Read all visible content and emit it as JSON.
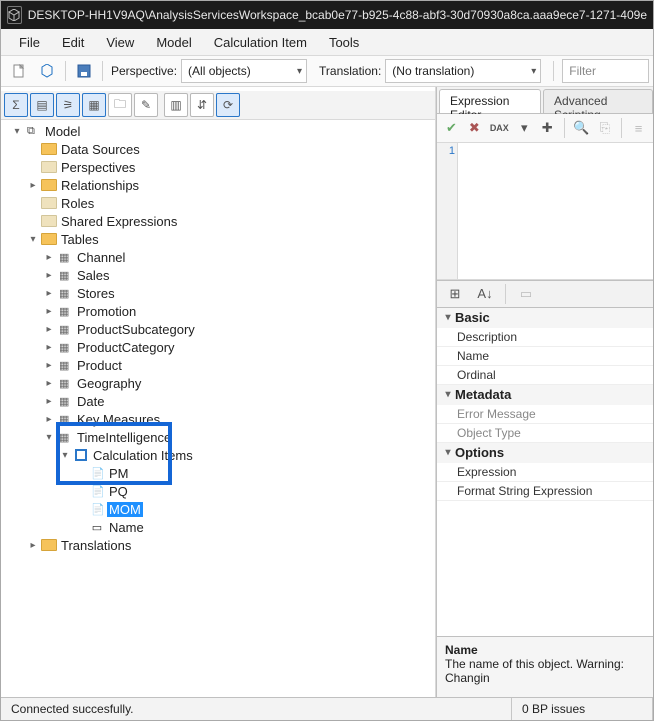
{
  "title": "DESKTOP-HH1V9AQ\\AnalysisServicesWorkspace_bcab0e77-b925-4c88-abf3-30d70930a8ca.aaa9ece7-1271-409e",
  "menu": [
    "File",
    "Edit",
    "View",
    "Model",
    "Calculation Item",
    "Tools"
  ],
  "toolbar": {
    "perspective_label": "Perspective:",
    "perspective_value": "(All objects)",
    "translation_label": "Translation:",
    "translation_value": "(No translation)",
    "filter_placeholder": "Filter"
  },
  "tree": {
    "root": "Model",
    "dataSources": "Data Sources",
    "perspectives": "Perspectives",
    "relationships": "Relationships",
    "roles": "Roles",
    "sharedExpr": "Shared Expressions",
    "tables": "Tables",
    "tablesList": [
      "Channel",
      "Sales",
      "Stores",
      "Promotion",
      "ProductSubcategory",
      "ProductCategory",
      "Product",
      "Geography",
      "Date",
      "Key Measures",
      "TimeIntelligence"
    ],
    "calcItems": "Calculation Items",
    "calcChildren": [
      "PM",
      "PQ",
      "MOM",
      "Name"
    ],
    "translations": "Translations"
  },
  "rightTabs": [
    "Expression Editor",
    "Advanced Scripting"
  ],
  "editor": {
    "line1": "1"
  },
  "props": {
    "cats": [
      "Basic",
      "Metadata",
      "Options"
    ],
    "basic": [
      "Description",
      "Name",
      "Ordinal"
    ],
    "metadata": [
      "Error Message",
      "Object Type"
    ],
    "options": [
      "Expression",
      "Format String Expression"
    ]
  },
  "propDesc": {
    "name": "Name",
    "text": "The name of this object. Warning: Changin"
  },
  "status": {
    "left": "Connected succesfully.",
    "right": "0 BP issues"
  }
}
